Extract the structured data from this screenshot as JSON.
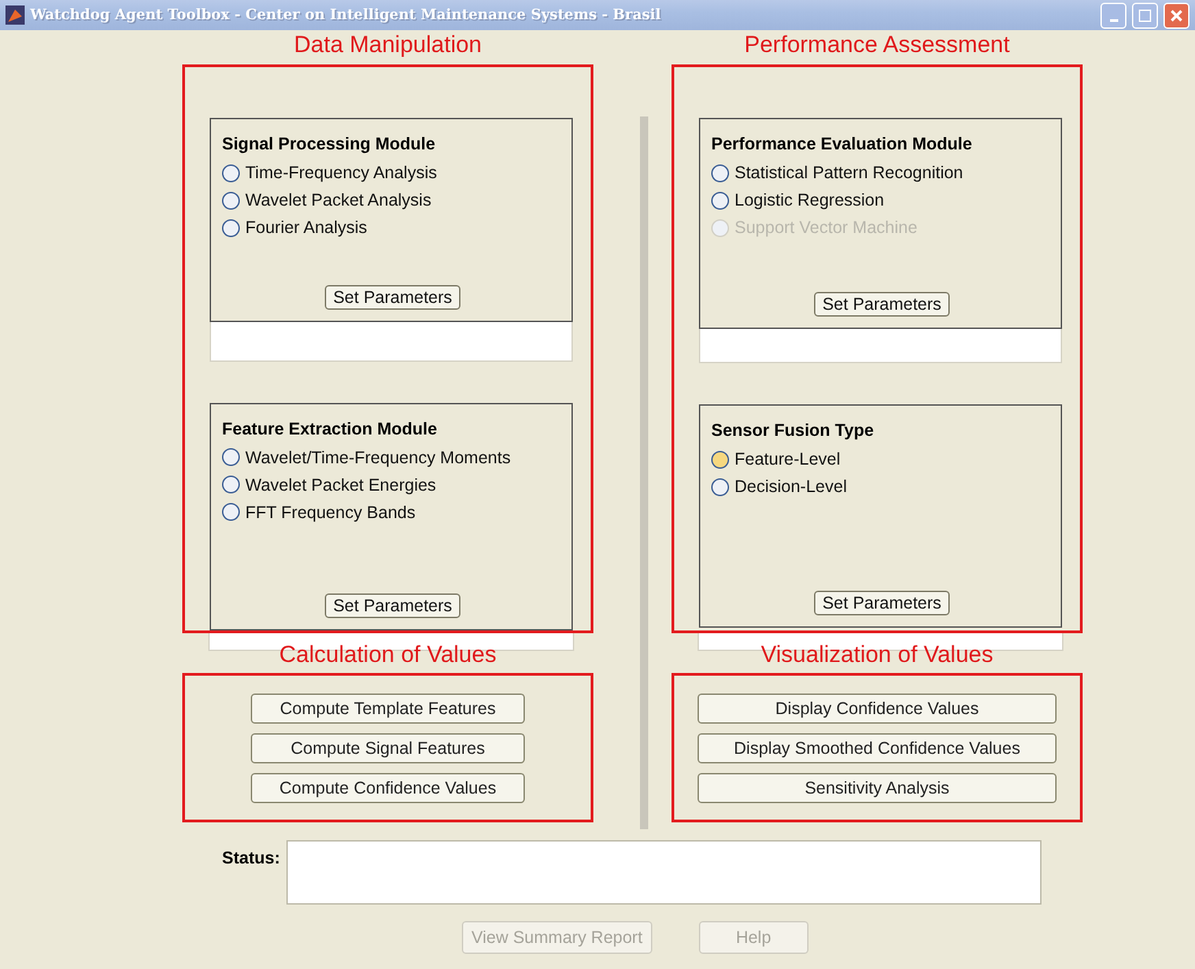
{
  "window": {
    "title": "Watchdog Agent Toolbox - Center on Intelligent Maintenance Systems - Brasil"
  },
  "columns": [
    {
      "heading": "Data Manipulation",
      "panels": [
        {
          "title": "Signal Processing Module",
          "options": [
            {
              "label": "Time-Frequency Analysis",
              "selected": false,
              "highlighted": false,
              "disabled": false
            },
            {
              "label": "Wavelet Packet Analysis",
              "selected": false,
              "highlighted": false,
              "disabled": false
            },
            {
              "label": "Fourier Analysis",
              "selected": false,
              "highlighted": false,
              "disabled": false
            }
          ],
          "button": "Set Parameters"
        },
        {
          "title": "Feature Extraction Module",
          "options": [
            {
              "label": "Wavelet/Time-Frequency Moments",
              "selected": false,
              "highlighted": false,
              "disabled": false
            },
            {
              "label": "Wavelet Packet Energies",
              "selected": false,
              "highlighted": false,
              "disabled": false
            },
            {
              "label": "FFT Frequency Bands",
              "selected": false,
              "highlighted": false,
              "disabled": false
            }
          ],
          "button": "Set Parameters"
        }
      ],
      "subheading": "Calculation of Values",
      "buttons": [
        "Compute Template Features",
        "Compute Signal Features",
        "Compute Confidence Values"
      ]
    },
    {
      "heading": "Performance Assessment",
      "panels": [
        {
          "title": "Performance Evaluation Module",
          "options": [
            {
              "label": "Statistical Pattern Recognition",
              "selected": false,
              "highlighted": false,
              "disabled": false
            },
            {
              "label": "Logistic Regression",
              "selected": false,
              "highlighted": false,
              "disabled": false
            },
            {
              "label": "Support Vector Machine",
              "selected": false,
              "highlighted": false,
              "disabled": true
            }
          ],
          "button": "Set Parameters"
        },
        {
          "title": "Sensor Fusion Type",
          "options": [
            {
              "label": "Feature-Level",
              "selected": false,
              "highlighted": true,
              "disabled": false
            },
            {
              "label": "Decision-Level",
              "selected": false,
              "highlighted": false,
              "disabled": false
            }
          ],
          "button": "Set Parameters"
        }
      ],
      "subheading": "Visualization of Values",
      "buttons": [
        "Display Confidence Values",
        "Display Smoothed Confidence Values",
        "Sensitivity Analysis"
      ]
    }
  ],
  "status": {
    "label": "Status:"
  },
  "footer_buttons": [
    {
      "label": "View Summary Report",
      "disabled": true
    },
    {
      "label": "Help",
      "disabled": true
    }
  ]
}
